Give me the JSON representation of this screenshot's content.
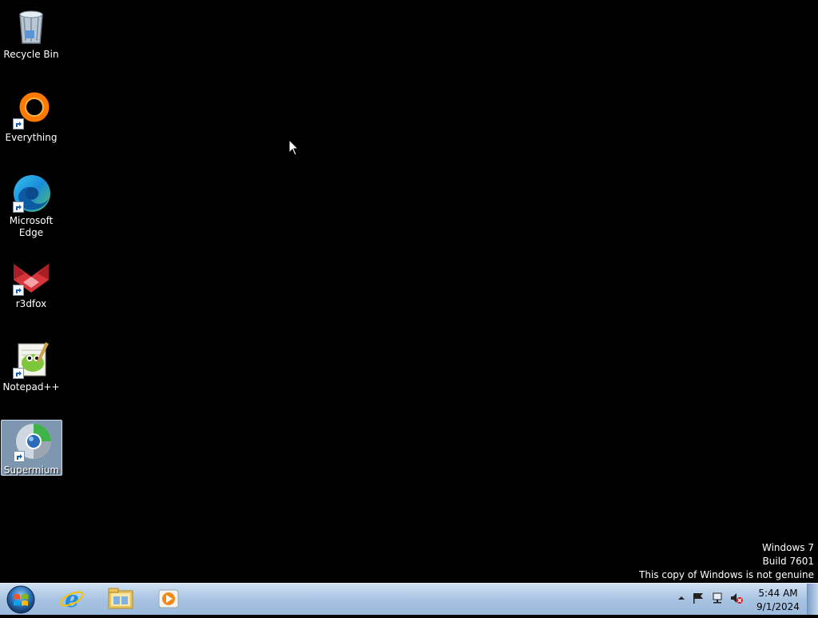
{
  "desktop": {
    "icons": [
      {
        "label": "Recycle Bin",
        "icon": "recycle-bin-icon"
      },
      {
        "label": "Everything",
        "icon": "everything-icon"
      },
      {
        "label": "Microsoft Edge",
        "icon": "edge-icon"
      },
      {
        "label": "r3dfox",
        "icon": "r3dfox-icon"
      },
      {
        "label": "Notepad++",
        "icon": "notepad-plus-plus-icon"
      },
      {
        "label": "Supermium",
        "icon": "supermium-icon"
      }
    ],
    "selected": "Supermium"
  },
  "watermark": {
    "line1": "Windows 7",
    "line2": "Build 7601",
    "line3": "This copy of Windows is not genuine"
  },
  "taskbar": {
    "pinned": [
      "internet-explorer-icon",
      "file-explorer-icon",
      "media-player-icon"
    ],
    "tray_icons": [
      "show-hidden-icons",
      "action-center-flag-icon",
      "network-icon",
      "volume-muted-icon"
    ],
    "clock": {
      "time": "5:44 AM",
      "date": "9/1/2024"
    }
  },
  "colors": {
    "desktop_bg": "#000000",
    "taskbar": "#a9c4e2",
    "selection": "#aac8eb"
  }
}
